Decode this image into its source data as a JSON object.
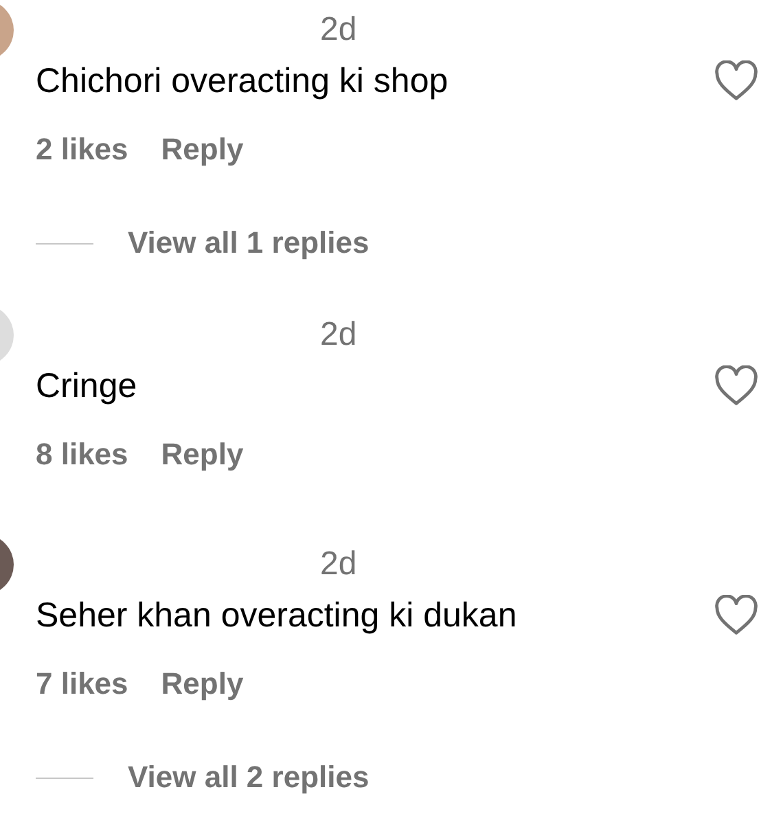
{
  "comments": [
    {
      "time": "2d",
      "text": "Chichori overacting ki shop",
      "likes": "2 likes",
      "reply": "Reply",
      "liked": false,
      "view_replies": "View all 1 replies"
    },
    {
      "time": "2d",
      "text": "Cringe",
      "likes": "8 likes",
      "reply": "Reply",
      "liked": false
    },
    {
      "time": "2d",
      "text": "Seher khan overacting ki dukan",
      "likes": "7 likes",
      "reply": "Reply",
      "liked": false,
      "view_replies": "View all 2 replies"
    }
  ]
}
